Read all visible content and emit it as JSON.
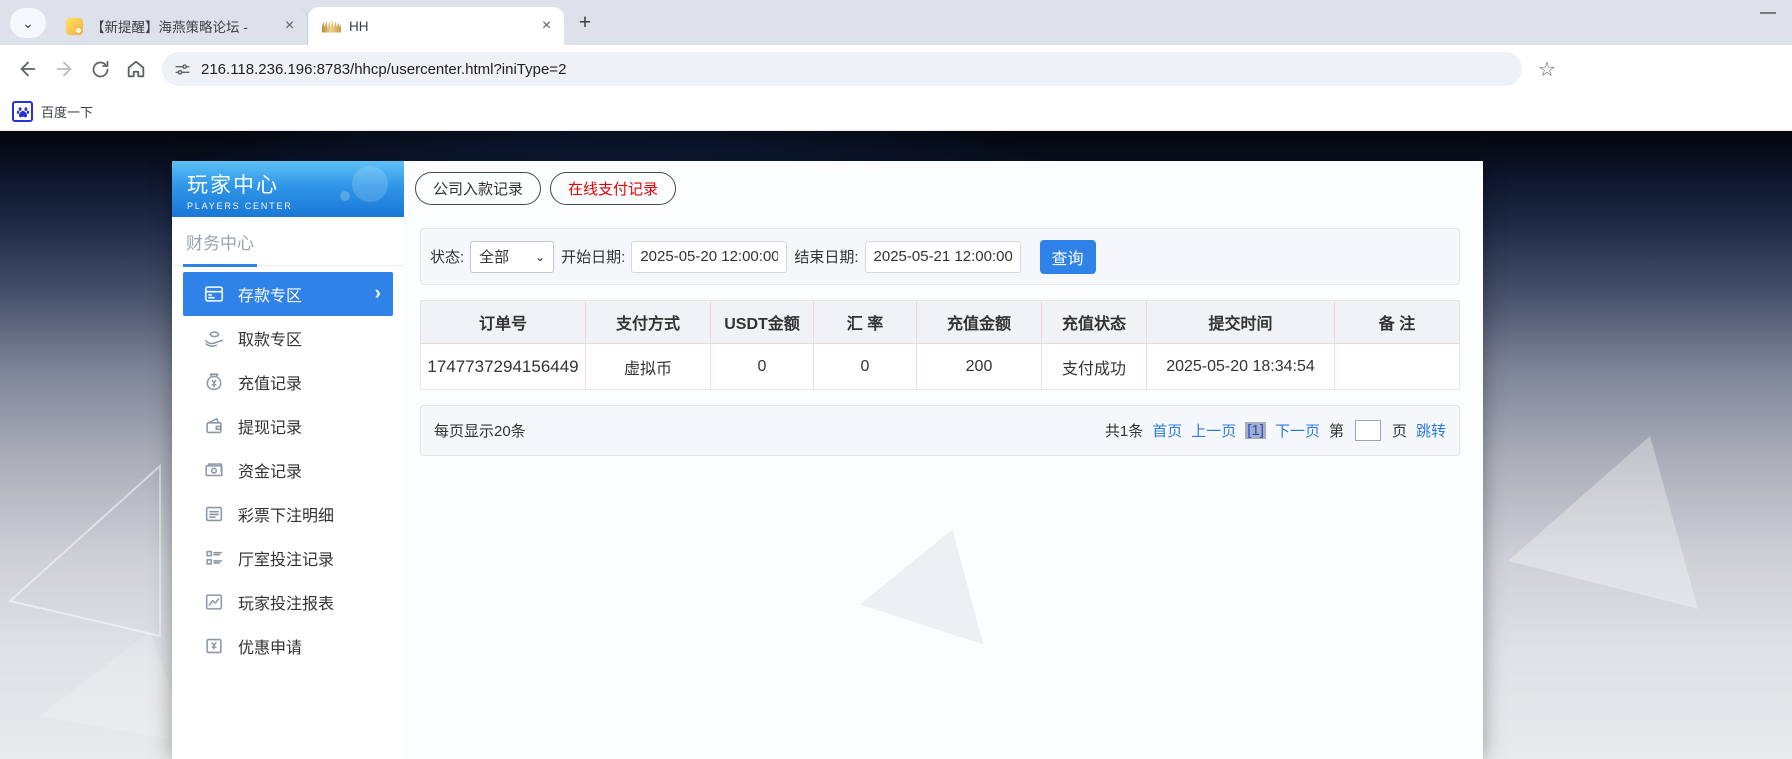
{
  "browser": {
    "tabs": [
      {
        "title": "【新提醒】海燕策略论坛 -",
        "active": false
      },
      {
        "title": "HH",
        "active": true
      }
    ],
    "url": "216.118.236.196:8783/hhcp/usercenter.html?iniType=2",
    "bookmark_label": "百度一下",
    "glyphs": {
      "tab_list_chevron": "⌄",
      "close": "×",
      "new_tab": "+",
      "minimize": "—",
      "star": "☆",
      "select_chevron": "⌄",
      "active_item_chevron": "›"
    }
  },
  "sidebar": {
    "banner": {
      "title": "玩家中心",
      "subtitle": "PLAYERS CENTER"
    },
    "section_title": "财务中心",
    "items": [
      {
        "label": "存款专区",
        "icon": "deposit-card-icon",
        "active": true
      },
      {
        "label": "取款专区",
        "icon": "withdraw-hand-icon",
        "active": false
      },
      {
        "label": "充值记录",
        "icon": "money-bag-icon",
        "active": false
      },
      {
        "label": "提现记录",
        "icon": "wallet-icon",
        "active": false
      },
      {
        "label": "资金记录",
        "icon": "cash-icon",
        "active": false
      },
      {
        "label": "彩票下注明细",
        "icon": "document-icon",
        "active": false
      },
      {
        "label": "厅室投注记录",
        "icon": "checklist-icon",
        "active": false
      },
      {
        "label": "玩家投注报表",
        "icon": "chart-icon",
        "active": false
      },
      {
        "label": "优惠申请",
        "icon": "coupon-icon",
        "active": false
      }
    ]
  },
  "content": {
    "tabs": [
      {
        "label": "公司入款记录",
        "active": false
      },
      {
        "label": "在线支付记录",
        "active": true
      }
    ],
    "filters": {
      "status_label": "状态:",
      "status_value": "全部",
      "start_label": "开始日期:",
      "start_value": "2025-05-20 12:00:00",
      "end_label": "结束日期:",
      "end_value": "2025-05-21 12:00:00",
      "search_button": "查询"
    },
    "table": {
      "headers": [
        "订单号",
        "支付方式",
        "USDT金额",
        "汇 率",
        "充值金额",
        "充值状态",
        "提交时间",
        "备 注"
      ],
      "rows": [
        [
          "1747737294156449",
          "虚拟币",
          "0",
          "0",
          "200",
          "支付成功",
          "2025-05-20 18:34:54",
          ""
        ]
      ]
    },
    "pagination": {
      "page_size_text": "每页显示20条",
      "total_text": "共1条",
      "first": "首页",
      "prev": "上一页",
      "current": "[1]",
      "next": "下一页",
      "jump_prefix": "第",
      "jump_suffix": "页",
      "jump_action": "跳转"
    }
  },
  "colors": {
    "accent": "#2e82e8",
    "link": "#2b7ce0",
    "active_tab_text": "#e60000",
    "banner_gradient_top": "#5ec1f5",
    "banner_gradient_bottom": "#1a77d6",
    "table_divider": "#f0d9d9"
  }
}
